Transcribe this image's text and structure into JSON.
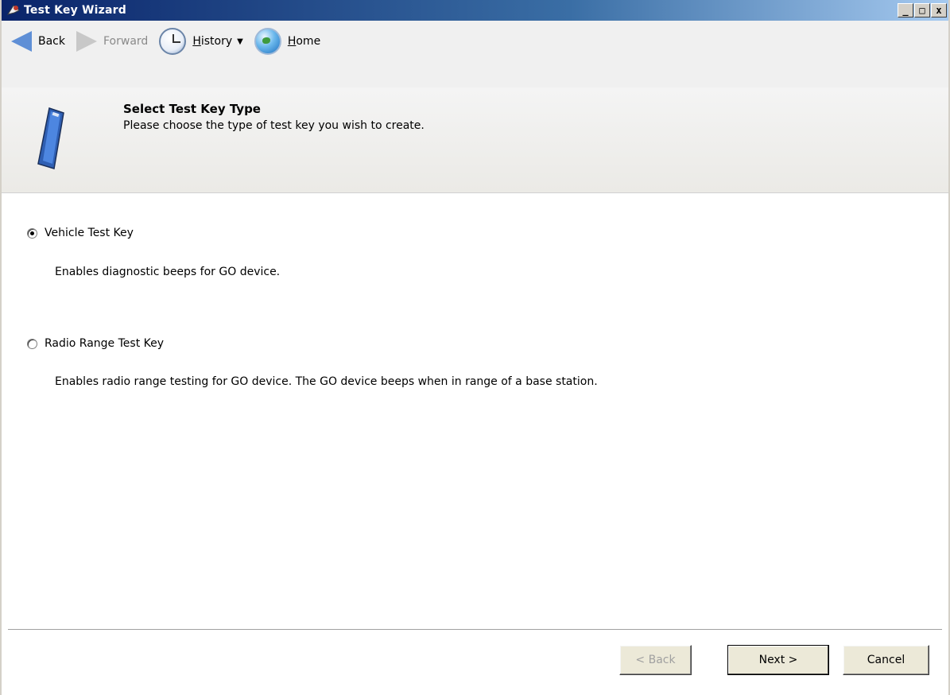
{
  "window": {
    "title": "Test Key Wizard",
    "controls": {
      "minimize": "_",
      "maximize": "□",
      "close": "x"
    }
  },
  "toolbar": {
    "back_label": "Back",
    "forward_label": "Forward",
    "history_label_first": "H",
    "history_label_rest": "istory",
    "home_label_first": "H",
    "home_label_rest": "ome",
    "icons": {
      "back": "arrow-left-icon",
      "forward": "arrow-right-icon",
      "history": "clock-icon",
      "home": "globe-icon"
    }
  },
  "header": {
    "title": "Select Test Key Type",
    "subtitle": "Please choose the type of test key you wish to create."
  },
  "options": [
    {
      "label": "Vehicle Test Key",
      "description": "Enables diagnostic beeps for GO device.",
      "selected": true
    },
    {
      "label": "Radio Range Test Key",
      "description": "Enables radio range testing for GO device. The GO device beeps when in range of a base station.",
      "selected": false
    }
  ],
  "footer": {
    "back_button": "< Back",
    "next_button": "Next >",
    "cancel_button": "Cancel"
  },
  "colors": {
    "titlebar_start": "#0a246a",
    "titlebar_end": "#a6caf0",
    "accent_blue": "#5f8fd6"
  }
}
